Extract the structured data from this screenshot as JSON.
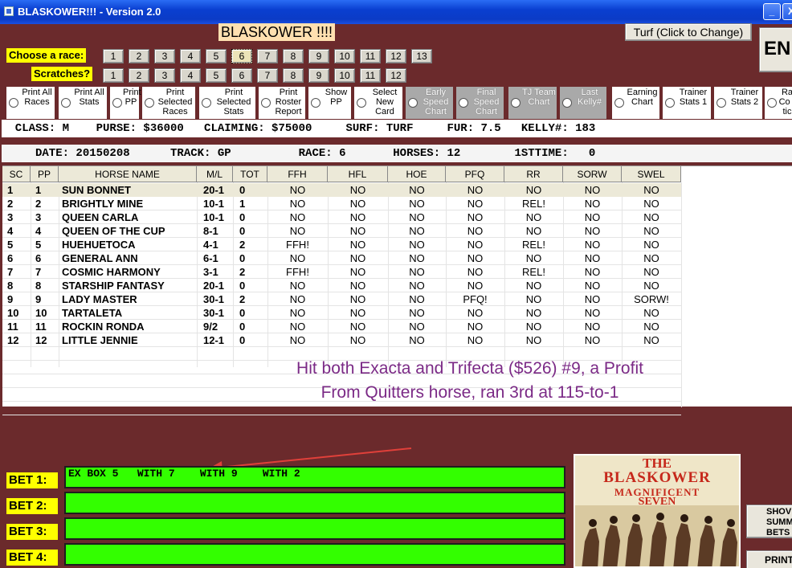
{
  "window": {
    "title": "BLASKOWER!!! - Version 2.0",
    "min": "_",
    "close": "X"
  },
  "app_title": "BLASKOWER !!!!",
  "surface_button": "Turf (Click to Change)",
  "end_button": "EN",
  "choose_race": {
    "label": "Choose  a race:",
    "numbers": [
      "1",
      "2",
      "3",
      "4",
      "5",
      "6",
      "7",
      "8",
      "9",
      "10",
      "11",
      "12",
      "13"
    ],
    "selected": "6"
  },
  "scratches": {
    "label": "Scratches?",
    "numbers": [
      "1",
      "2",
      "3",
      "4",
      "5",
      "6",
      "7",
      "8",
      "9",
      "10",
      "11",
      "12"
    ]
  },
  "options": [
    {
      "label": "Print All Races",
      "style": "white"
    },
    {
      "label": "Print All Stats",
      "style": "white"
    },
    {
      "label": "Print PP",
      "style": "white"
    },
    {
      "label": "Print Selected Races",
      "style": "white"
    },
    {
      "label": "Print Selected Stats",
      "style": "white"
    },
    {
      "label": "Print Roster Report",
      "style": "white"
    },
    {
      "label": "Show PP",
      "style": "white"
    },
    {
      "label": "Select New Card",
      "style": "white"
    },
    {
      "label": "Early Speed Chart",
      "style": "gray"
    },
    {
      "label": "Final Speed Chart",
      "style": "gray"
    },
    {
      "label": "TJ Team Chart",
      "style": "gray"
    },
    {
      "label": "Last Kelly#",
      "style": "gray"
    },
    {
      "label": "Earning Chart",
      "style": "white"
    },
    {
      "label": "Trainer Stats 1",
      "style": "white"
    },
    {
      "label": "Trainer Stats 2",
      "style": "white"
    },
    {
      "label": "Ra Co -tic",
      "style": "white"
    }
  ],
  "race_info": "  CLASS: M    PURSE: $36000   CLAIMING: $75000     SURF: TURF     FUR: 7.5   KELLY#: 183",
  "race_header": "     DATE: 20150208      TRACK: GP          RACE: 6       HORSES: 12        1STTIME:   0",
  "table": {
    "columns": [
      "SC",
      "PP",
      "HORSE NAME",
      "M/L",
      "TOT",
      "FFH",
      "HFL",
      "HOE",
      "PFQ",
      "RR",
      "SORW",
      "SWEL"
    ],
    "rows": [
      [
        "1",
        "1",
        "SUN BONNET",
        "20-1",
        "0",
        "NO",
        "NO",
        "NO",
        "NO",
        "NO",
        "NO",
        "NO"
      ],
      [
        "2",
        "2",
        "BRIGHTLY MINE",
        "10-1",
        "1",
        "NO",
        "NO",
        "NO",
        "NO",
        "REL!",
        "NO",
        "NO"
      ],
      [
        "3",
        "3",
        "QUEEN CARLA",
        "10-1",
        "0",
        "NO",
        "NO",
        "NO",
        "NO",
        "NO",
        "NO",
        "NO"
      ],
      [
        "4",
        "4",
        "QUEEN OF THE CUP",
        "8-1",
        "0",
        "NO",
        "NO",
        "NO",
        "NO",
        "NO",
        "NO",
        "NO"
      ],
      [
        "5",
        "5",
        "HUEHUETOCA",
        "4-1",
        "2",
        "FFH!",
        "NO",
        "NO",
        "NO",
        "REL!",
        "NO",
        "NO"
      ],
      [
        "6",
        "6",
        "GENERAL ANN",
        "6-1",
        "0",
        "NO",
        "NO",
        "NO",
        "NO",
        "NO",
        "NO",
        "NO"
      ],
      [
        "7",
        "7",
        "COSMIC HARMONY",
        "3-1",
        "2",
        "FFH!",
        "NO",
        "NO",
        "NO",
        "REL!",
        "NO",
        "NO"
      ],
      [
        "8",
        "8",
        "STARSHIP FANTASY",
        "20-1",
        "0",
        "NO",
        "NO",
        "NO",
        "NO",
        "NO",
        "NO",
        "NO"
      ],
      [
        "9",
        "9",
        "LADY MASTER",
        "30-1",
        "2",
        "NO",
        "NO",
        "NO",
        "PFQ!",
        "NO",
        "NO",
        "SORW!"
      ],
      [
        "10",
        "10",
        "TARTALETA",
        "30-1",
        "0",
        "NO",
        "NO",
        "NO",
        "NO",
        "NO",
        "NO",
        "NO"
      ],
      [
        "11",
        "11",
        "ROCKIN RONDA",
        "9/2",
        "0",
        "NO",
        "NO",
        "NO",
        "NO",
        "NO",
        "NO",
        "NO"
      ],
      [
        "12",
        "12",
        "LITTLE JENNIE",
        "12-1",
        "0",
        "NO",
        "NO",
        "NO",
        "NO",
        "NO",
        "NO",
        "NO"
      ]
    ]
  },
  "annotation": {
    "line1": "Hit both Exacta and Trifecta ($526) #9, a Profit",
    "line2": "From Quitters horse, ran 3rd at 115-to-1"
  },
  "bets": [
    {
      "label": "BET 1:",
      "value": "EX BOX 5   WITH 7    WITH 9    WITH 2"
    },
    {
      "label": "BET 2:",
      "value": ""
    },
    {
      "label": "BET 3:",
      "value": ""
    },
    {
      "label": "BET 4:",
      "value": ""
    }
  ],
  "poster": {
    "line1": "THE",
    "line2": "BLASKOWER",
    "line3": "MAGNIFICENT",
    "line4": "SEVEN"
  },
  "right_buttons": {
    "show": "SHOV SUMMA BETS",
    "print": "PRINT"
  },
  "colors": {
    "background": "#6b2a2c",
    "bet_green": "#33ff00",
    "label_yellow": "#ffff00",
    "annotation": "#7b2a86",
    "arrow": "#e0403a"
  }
}
